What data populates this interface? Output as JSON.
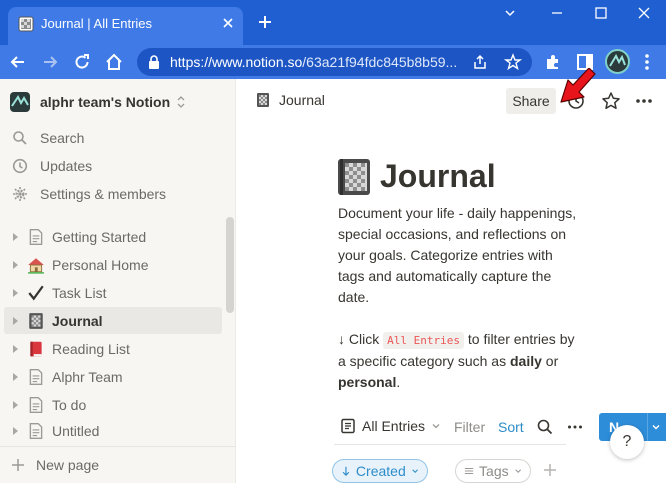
{
  "browser": {
    "tab_title": "Journal | All Entries",
    "url_domain": "https://www.notion.so",
    "url_path": "/63a21f94fdc845b8b59...",
    "accent_color": "#1f5fd1"
  },
  "sidebar": {
    "workspace_name": "alphr team's Notion",
    "links": [
      {
        "label": "Search",
        "icon": "search-icon"
      },
      {
        "label": "Updates",
        "icon": "clock-icon"
      },
      {
        "label": "Settings & members",
        "icon": "gear-icon"
      }
    ],
    "pages": [
      {
        "label": "Getting Started",
        "icon": "document-icon"
      },
      {
        "label": "Personal Home",
        "icon": "house-emoji-icon"
      },
      {
        "label": "Task List",
        "icon": "checkmark-icon"
      },
      {
        "label": "Journal",
        "icon": "notebook-icon",
        "active": true
      },
      {
        "label": "Reading List",
        "icon": "red-book-icon"
      },
      {
        "label": "Alphr Team",
        "icon": "document-icon"
      },
      {
        "label": "To do",
        "icon": "document-icon"
      },
      {
        "label": "Untitled",
        "icon": "document-icon"
      }
    ],
    "new_page_label": "New page"
  },
  "topbar": {
    "breadcrumb": "Journal",
    "share_label": "Share"
  },
  "page": {
    "title": "Journal",
    "description": "Document your life - daily happenings, special occasions, and reflections on your goals. Categorize entries with tags and automatically capture the date.",
    "hint_prefix": "↓ Click ",
    "hint_code": "All Entries",
    "hint_middle": " to filter entries by a specific category such as ",
    "hint_bold1": "daily",
    "hint_or": " or ",
    "hint_bold2": "personal",
    "hint_end": "."
  },
  "database": {
    "view_label": "All Entries",
    "filter_label": "Filter",
    "sort_label": "Sort",
    "new_label": "N",
    "help_label": "?",
    "chips": [
      {
        "label": "Created",
        "icon": "arrow-down-icon"
      },
      {
        "label": "Tags",
        "icon": "list-icon"
      }
    ]
  }
}
